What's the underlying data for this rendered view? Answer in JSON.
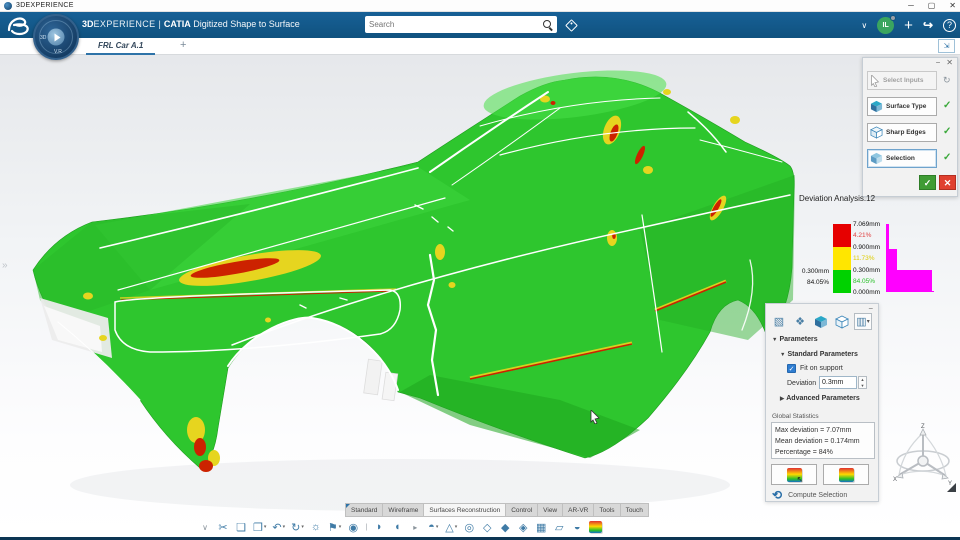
{
  "window": {
    "title": "3DEXPERIENCE",
    "controls": {
      "minimize": "─",
      "maximize": "▢",
      "close": "✕"
    }
  },
  "app_bar": {
    "brand_bold": "3D",
    "brand_rest": "EXPERIENCE",
    "pipe": "|",
    "product": "CATIA",
    "subtitle": "Digitized Shape to Surface",
    "search_placeholder": "Search",
    "user_initials": "IL",
    "chevron": "∨",
    "plus": "+",
    "share": "↪",
    "help": "?"
  },
  "compass": {
    "label_3d": "3D",
    "label_vr": "V.R"
  },
  "tab_bar": {
    "active_tab": "FRL Car A.1",
    "new_tab": "+",
    "collapse_icon": "⇲"
  },
  "viewport": {
    "left_expander": "»"
  },
  "assistant_panel": {
    "minimize": "−",
    "close": "✕",
    "steps": [
      {
        "label": "Select Inputs"
      },
      {
        "label": "Surface Type"
      },
      {
        "label": "Sharp Edges"
      },
      {
        "label": "Selection"
      }
    ],
    "check": "✓",
    "edit": "↻",
    "ok": "✓",
    "cancel": "✕"
  },
  "deviation_scale": {
    "title": "Deviation Analysis.12",
    "v1": "7.069mm",
    "p1": "4.21%",
    "v2": "0.900mm",
    "p2": "11.73%",
    "v3": "0.300mm",
    "p3": "84.05%",
    "v4": "0.000mm",
    "readout_value": "0.300mm",
    "readout_pct": "84.05%",
    "band_colors": {
      "high": "#e60000",
      "mid": "#ffe600",
      "low": "#00d200"
    },
    "histogram_color": "#ff00ff",
    "histogram_percents": [
      4.21,
      11.73,
      84.05
    ]
  },
  "parameters_panel": {
    "minimize": "−",
    "dropdown": "▾",
    "parameters_label": "Parameters",
    "standard_label": "Standard Parameters",
    "fit_on_support": "Fit on support",
    "fit_checked": "✓",
    "deviation_label": "Deviation",
    "deviation_value": "0.3mm",
    "spin_up": "▲",
    "spin_down": "▼",
    "advanced_label": "Advanced Parameters",
    "global_stats_title": "Global Statistics",
    "stat_1": "Max deviation = 7.07mm",
    "stat_2": "Mean deviation = 0.174mm",
    "stat_3": "Percentage = 84%",
    "compute_icon": "⟲",
    "compute_label": "Compute Selection",
    "cursor_glyph": "↖"
  },
  "bottom_bar": {
    "tabs": [
      "Standard",
      "Wireframe",
      "Surfaces Reconstruction",
      "Control",
      "View",
      "AR-VR",
      "Tools",
      "Touch"
    ],
    "active_tab": "Surfaces Reconstruction"
  },
  "toolbar": {
    "icons": [
      {
        "name": "toolbar-expand",
        "glyph": "∨"
      },
      {
        "name": "cut",
        "glyph": "✂"
      },
      {
        "name": "copy",
        "glyph": "❏"
      },
      {
        "name": "paste",
        "glyph": "❐"
      },
      {
        "name": "undo",
        "glyph": "↶"
      },
      {
        "name": "update",
        "glyph": "↻"
      },
      {
        "name": "render-style",
        "glyph": "☼"
      },
      {
        "name": "report",
        "glyph": "⚑"
      },
      {
        "name": "capture",
        "glyph": "◉"
      },
      {
        "name": "surface-morph",
        "glyph": "◗"
      },
      {
        "name": "power-fit",
        "glyph": "◖"
      },
      {
        "name": "more-tools",
        "glyph": "▸"
      },
      {
        "name": "shape-volume",
        "glyph": "◓"
      },
      {
        "name": "primitives",
        "glyph": "△"
      },
      {
        "name": "mesh-sphere",
        "glyph": "◎"
      },
      {
        "name": "surface-patch",
        "glyph": "◇"
      },
      {
        "name": "surface-sweep",
        "glyph": "◆"
      },
      {
        "name": "surface-corner",
        "glyph": "◈"
      },
      {
        "name": "activate-patch",
        "glyph": "▦"
      },
      {
        "name": "bend-sheet",
        "glyph": "▱"
      },
      {
        "name": "paint-transfer",
        "glyph": "◒"
      }
    ],
    "dropdown": "▾",
    "separator": "|"
  },
  "triad": {
    "z": "Z",
    "x": "X",
    "y": "Y"
  },
  "colors": {
    "app_bar_blue": "#14578c",
    "accent_blue": "#2e73a8",
    "model_green": "#2ec62e",
    "deviation_red": "#cc2200",
    "deviation_yellow": "#e6d51f",
    "magenta": "#ff00ff",
    "ok_green": "#3f9c35",
    "cancel_red": "#e0402f",
    "avatar_green": "#3aa55f"
  }
}
